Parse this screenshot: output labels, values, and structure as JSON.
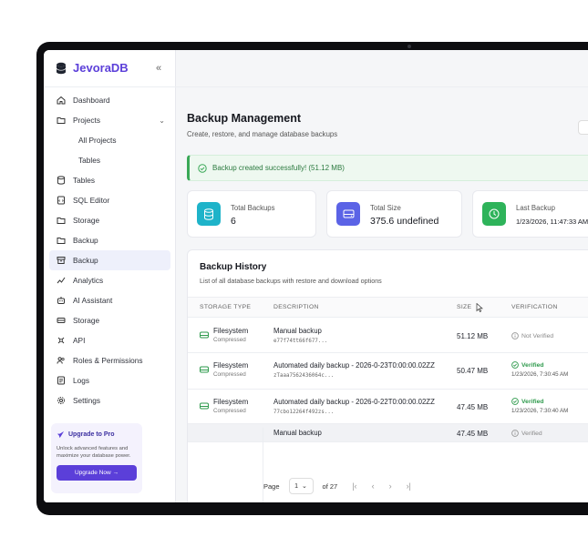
{
  "app": {
    "name": "JevoraDB",
    "collapse_icon": "double-chevron-left-icon"
  },
  "sidebar": {
    "items": [
      {
        "label": "Dashboard",
        "icon": "home-icon"
      },
      {
        "label": "Projects",
        "icon": "folder-open-icon",
        "caret": "⌄"
      },
      {
        "label": "All Projects",
        "sub": true
      },
      {
        "label": "Tables",
        "sub": true
      },
      {
        "label": "Tables",
        "icon": "database-icon"
      },
      {
        "label": "SQL Editor",
        "icon": "file-code-icon"
      },
      {
        "label": "Storage",
        "icon": "folder-icon"
      },
      {
        "label": "Backup",
        "icon": "folder-icon"
      },
      {
        "label": "Backup",
        "icon": "archive-icon",
        "active": true
      },
      {
        "label": "Analytics",
        "icon": "chart-icon"
      },
      {
        "label": "AI Assistant",
        "icon": "bot-icon"
      },
      {
        "label": "Storage",
        "icon": "drive-icon"
      },
      {
        "label": "API",
        "icon": "api-icon"
      },
      {
        "label": "Roles & Permissions",
        "icon": "users-icon"
      },
      {
        "label": "Logs",
        "icon": "log-icon"
      },
      {
        "label": "Settings",
        "icon": "gear-icon"
      }
    ],
    "upgrade": {
      "title": "Upgrade to Pro",
      "description": "Unlock advanced features and maximize your database power.",
      "button": "Upgrade Now →"
    }
  },
  "page": {
    "title": "Backup Management",
    "subtitle": "Create, restore, and manage database backups"
  },
  "alert": {
    "text": "Backup created successfully! (51.12 MB)"
  },
  "stats": [
    {
      "label": "Total Backups",
      "value": "6",
      "color": "#1eb3c9"
    },
    {
      "label": "Total Size",
      "value": "375.6 undefined",
      "color": "#5b63e6"
    },
    {
      "label": "Last Backup",
      "value": "1/23/2026, 11:47:33 AM",
      "color": "#2eb35a"
    }
  ],
  "history": {
    "title": "Backup History",
    "subtitle": "List of all database backups with restore and download options",
    "columns": [
      "STORAGE TYPE",
      "DESCRIPTION",
      "SIZE",
      "VERIFICATION"
    ],
    "rows": [
      {
        "storage": "Filesystem",
        "storage_sub": "Compressed",
        "description": "Manual backup",
        "id": "e77f74tt66f677...",
        "size": "51.12 MB",
        "verification": "Not Verified",
        "verified": false,
        "date": ""
      },
      {
        "storage": "Filesystem",
        "storage_sub": "Compressed",
        "description": "Automated daily backup - 2026-0-23T0:00:00.02ZZ",
        "id": "zTaaa7562436064c...",
        "size": "50.47 MB",
        "verification": "Verified",
        "verified": true,
        "date": "1/23/2026, 7:30:45 AM"
      },
      {
        "storage": "Filesystem",
        "storage_sub": "Compressed",
        "description": "Automated daily backup - 2026-0-22T0:00:00.02ZZ",
        "id": "77cbo12264f492zs...",
        "size": "47.45 MB",
        "verification": "Verified",
        "verified": true,
        "date": "1/23/2026, 7:30:40 AM"
      },
      {
        "storage": "",
        "storage_sub": "",
        "description": "Manual backup",
        "id": "",
        "size": "47.45 MB",
        "verification": "Verified",
        "verified": false,
        "date": ""
      }
    ],
    "pager": {
      "label": "Page",
      "current": "1",
      "of": "of 27"
    }
  }
}
